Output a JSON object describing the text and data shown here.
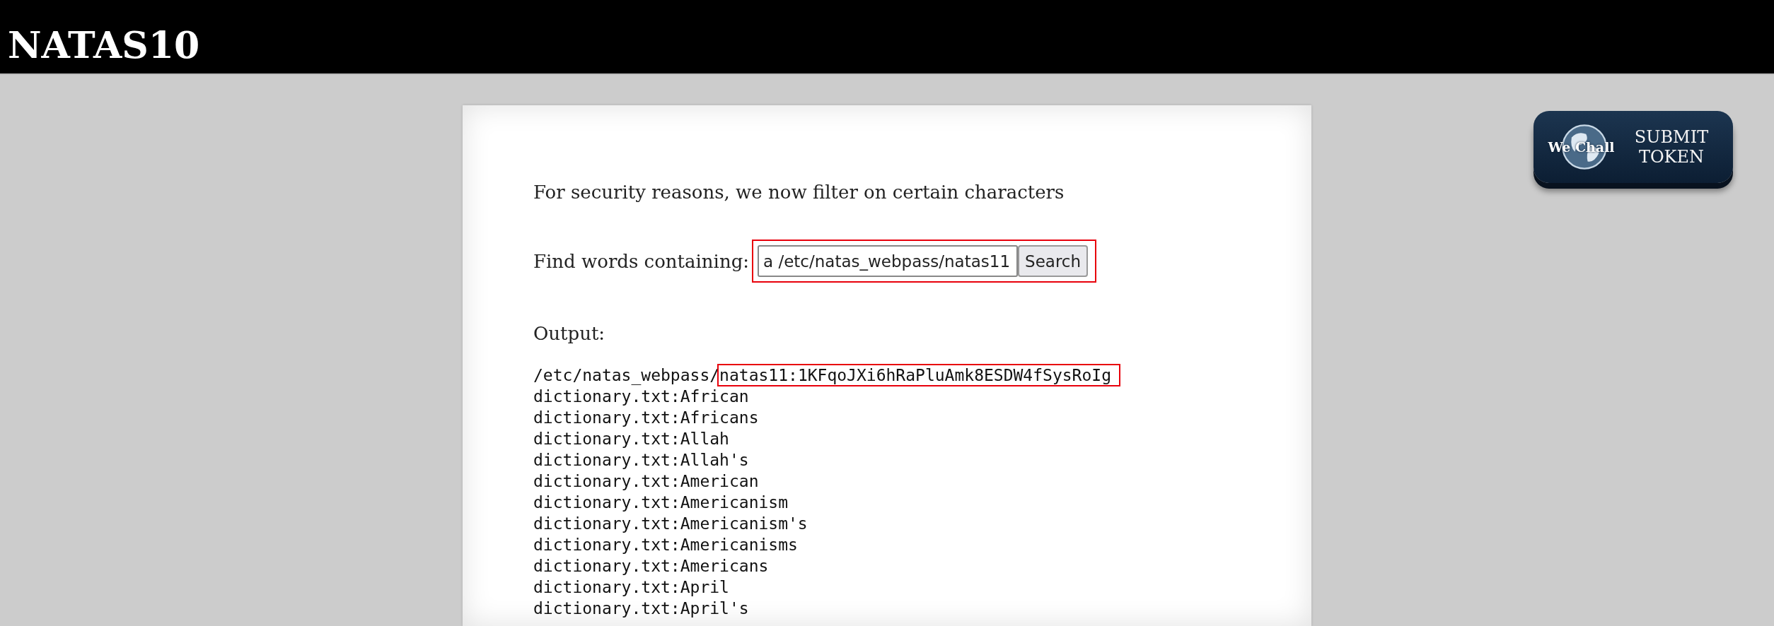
{
  "header": {
    "title": "NATAS10"
  },
  "wechall_button": {
    "logo": "We Chall",
    "label": "SUBMIT TOKEN"
  },
  "content": {
    "notice": "For security reasons, we now filter on certain characters",
    "form": {
      "label": "Find words containing:",
      "value": "a /etc/natas_webpass/natas11",
      "button": "Search",
      "highlighted": true
    },
    "output_heading": "Output:",
    "output_lines": [
      {
        "text": "/etc/natas_webpass/",
        "highlight": "natas11:1KFqoJXi6hRaPluAmk8ESDW4fSysRoIg"
      },
      {
        "text": "dictionary.txt:African"
      },
      {
        "text": "dictionary.txt:Africans"
      },
      {
        "text": "dictionary.txt:Allah"
      },
      {
        "text": "dictionary.txt:Allah's"
      },
      {
        "text": "dictionary.txt:American"
      },
      {
        "text": "dictionary.txt:Americanism"
      },
      {
        "text": "dictionary.txt:Americanism's"
      },
      {
        "text": "dictionary.txt:Americanisms"
      },
      {
        "text": "dictionary.txt:Americans"
      },
      {
        "text": "dictionary.txt:April"
      },
      {
        "text": "dictionary.txt:April's"
      }
    ]
  }
}
